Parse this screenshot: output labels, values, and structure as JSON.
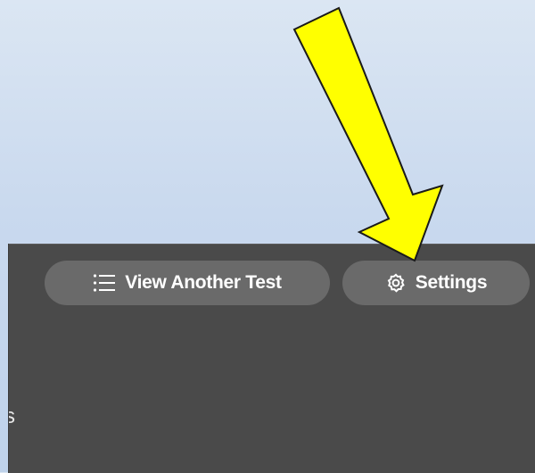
{
  "toolbar": {
    "view_another_test_label": "View Another Test",
    "settings_label": "Settings"
  },
  "icons": {
    "view_another_test": "list-icon",
    "settings": "gear-icon"
  },
  "edge_text": "s",
  "colors": {
    "panel_background": "#4a4a4a",
    "pill_background": "#6a6a6a",
    "arrow_fill": "#ffff00",
    "page_background": "#c9d9ee"
  }
}
